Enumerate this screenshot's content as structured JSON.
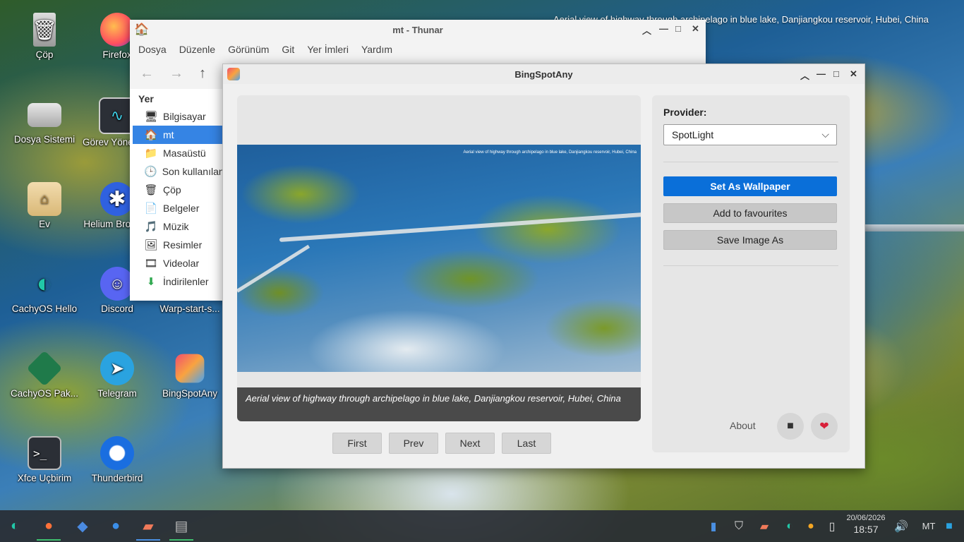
{
  "wallpaper_caption": "Aerial view of highway through archipelago in blue lake, Danjiangkou reservoir, Hubei, China",
  "desktop_icons": [
    {
      "label": "Çöp",
      "icon": "trash-icon"
    },
    {
      "label": "Firefox",
      "icon": "firefox-icon"
    },
    {
      "label": "Dosya Sistemi",
      "icon": "drive-icon"
    },
    {
      "label": "Görev Yöneticisi",
      "icon": "task-manager-icon"
    },
    {
      "label": "Ev",
      "icon": "home-folder-icon"
    },
    {
      "label": "Helium Browser",
      "icon": "helium-icon"
    },
    {
      "label": "CachyOS Hello",
      "icon": "cachyos-icon"
    },
    {
      "label": "Discord",
      "icon": "discord-icon"
    },
    {
      "label": "Warp-start-s...",
      "icon": "script-icon"
    },
    {
      "label": "CachyOS Pak...",
      "icon": "package-icon"
    },
    {
      "label": "Telegram",
      "icon": "telegram-icon"
    },
    {
      "label": "BingSpotAny",
      "icon": "bingspotany-icon"
    },
    {
      "label": "Xfce Uçbirim",
      "icon": "terminal-icon"
    },
    {
      "label": "Thunderbird",
      "icon": "thunderbird-icon"
    }
  ],
  "thunar": {
    "title": "mt - Thunar",
    "menu": [
      "Dosya",
      "Düzenle",
      "Görünüm",
      "Git",
      "Yer İmleri",
      "Yardım"
    ],
    "sidebar_header": "Yer",
    "places": [
      {
        "label": "Bilgisayar",
        "icon": "computer-icon",
        "glyph": "🖥"
      },
      {
        "label": "mt",
        "icon": "home-icon",
        "glyph": "🏠",
        "selected": true
      },
      {
        "label": "Masaüstü",
        "icon": "folder-icon",
        "glyph": "📁"
      },
      {
        "label": "Son kullanılanlar",
        "icon": "recent-icon",
        "glyph": "🕒"
      },
      {
        "label": "Çöp",
        "icon": "trash-icon",
        "glyph": "🗑"
      },
      {
        "label": "Belgeler",
        "icon": "documents-icon",
        "glyph": "📄"
      },
      {
        "label": "Müzik",
        "icon": "music-icon",
        "glyph": "🎵"
      },
      {
        "label": "Resimler",
        "icon": "pictures-icon",
        "glyph": "🖼"
      },
      {
        "label": "Videolar",
        "icon": "videos-icon",
        "glyph": "🎞"
      },
      {
        "label": "İndirilenler",
        "icon": "downloads-icon",
        "glyph": "⬇"
      }
    ]
  },
  "bsa": {
    "title": "BingSpotAny",
    "image_caption": "Aerial view of highway through archipelago in blue lake, Danjiangkou reservoir, Hubei, China",
    "nav": {
      "first": "First",
      "prev": "Prev",
      "next": "Next",
      "last": "Last"
    },
    "provider_label": "Provider:",
    "provider_value": "SpotLight",
    "set_wallpaper": "Set As Wallpaper",
    "add_favourites": "Add to favourites",
    "save_image": "Save Image As",
    "about": "About",
    "accent_color": "#0a6fd9"
  },
  "taskbar": {
    "date": "20/06/2026",
    "time": "18:57",
    "user": "MT"
  }
}
